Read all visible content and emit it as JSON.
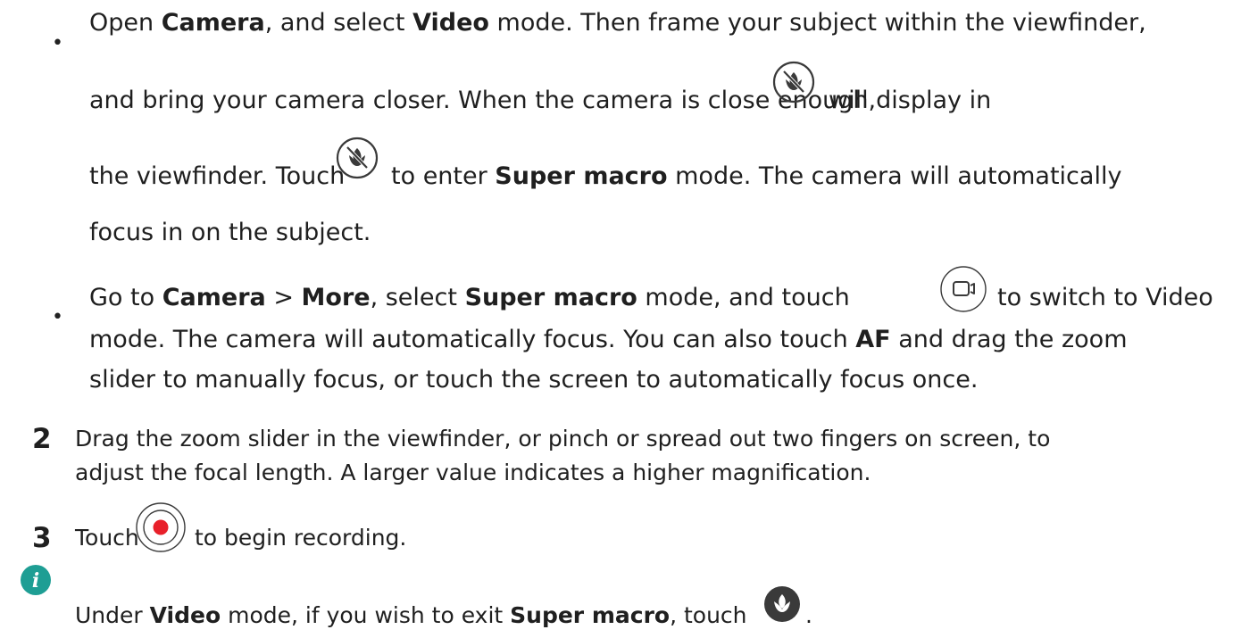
{
  "bullets": [
    {
      "lines": [
        {
          "t1": "Open ",
          "b1": "Camera",
          "t2": ", and select ",
          "b2": "Video",
          "t3": " mode. Then frame your subject within the viewfinder,"
        },
        {
          "t1": "and bring your camera closer. When the camera is close enough,",
          "t2": "will display in"
        },
        {
          "t1": "the viewfinder. Touch",
          "t2": "to enter ",
          "b1": "Super macro",
          "t3": " mode. The camera will automatically"
        },
        {
          "t1": "focus in on the subject."
        }
      ]
    },
    {
      "lines": [
        {
          "t1": "Go to ",
          "b1": "Camera",
          "t2": " > ",
          "b2": "More",
          "t3": ", select ",
          "b3": "Super macro",
          "t4": " mode, and touch",
          "t5": "to switch to Video"
        },
        {
          "t1": "mode. The camera will automatically focus. You can also touch ",
          "b1": "AF",
          "t2": " and drag the zoom"
        },
        {
          "t1": "slider to manually focus, or touch the screen to automatically focus once."
        }
      ]
    }
  ],
  "steps": [
    {
      "number": "2",
      "lines": [
        "Drag the zoom slider in the viewfinder, or pinch or spread out two fingers on screen, to",
        "adjust the focal length. A larger value indicates a higher magnification."
      ]
    },
    {
      "number": "3",
      "t1": "Touch",
      "t2": "to begin recording."
    }
  ],
  "note": {
    "t1": "Under ",
    "b1": "Video",
    "t2": " mode, if you wish to exit ",
    "b2": "Super macro",
    "t3": ", touch",
    "t4": "."
  },
  "bullet_char": "•",
  "colors": {
    "text": "#1f1f1f",
    "info_teal": "#1e9e94",
    "record_red": "#e8202a",
    "icon_dark": "#3a3a3a"
  },
  "icons": [
    "super-macro-icon",
    "video-mode-icon",
    "record-button-icon",
    "info-icon",
    "macro-exit-icon"
  ]
}
